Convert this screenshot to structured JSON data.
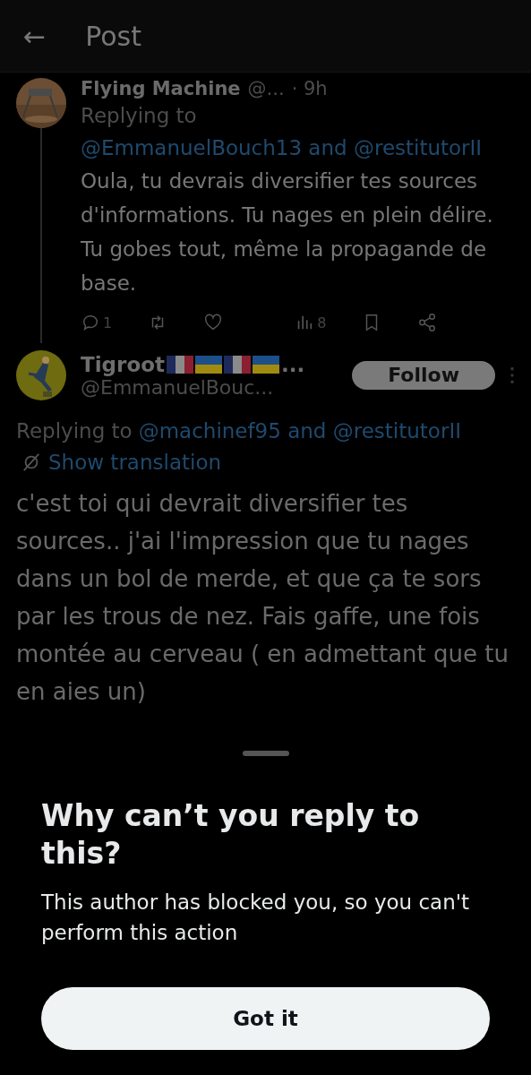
{
  "header": {
    "back": "←",
    "title": "Post"
  },
  "parent": {
    "author": "Flying Machine",
    "handle": "@...",
    "time": "· 9h",
    "replying_prefix": "Replying to",
    "replying_to": "@EmmanuelBouch13 and @restitutorII",
    "text": "Oula, tu devrais diversifier tes sources d'informations. Tu nages en plein délire. Tu gobes tout, même la propagande de base.",
    "actions": [
      {
        "kind": "reply",
        "count": "1"
      },
      {
        "kind": "repost"
      },
      {
        "kind": "like"
      },
      {
        "kind": "views",
        "count": "8"
      },
      {
        "kind": "bookmark"
      },
      {
        "kind": "share"
      }
    ]
  },
  "post": {
    "author": "Tigroot",
    "flags": [
      {
        "kind": "france"
      },
      {
        "kind": "ukraine"
      },
      {
        "kind": "france"
      },
      {
        "kind": "ukraine"
      }
    ],
    "ellipsis": "...",
    "handle": "@EmmanuelBouc...",
    "follow": "Follow",
    "replying_prefix": "Replying to",
    "replying_to": "@machinef95 and @restitutorII",
    "translate": "Show translation",
    "text": "c'est toi qui devrait diversifier tes sources.. j'ai l'impression que tu nages dans un bol de merde, et que ça te sors par les trous de nez. Fais gaffe, une fois montée au cerveau ( en admettant que tu en aies un)"
  },
  "sheet": {
    "title": "Why can’t you reply to this?",
    "body": "This author has blocked you, so you can't perform this action",
    "button": "Got it"
  }
}
